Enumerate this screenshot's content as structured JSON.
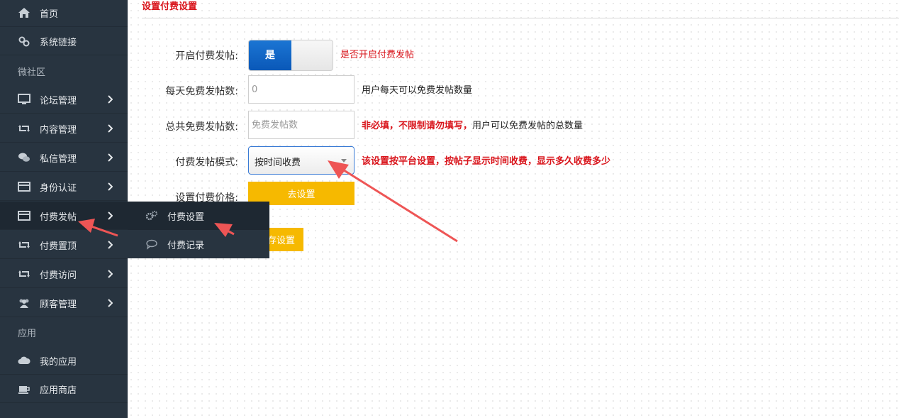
{
  "sidebar": {
    "items": [
      {
        "label": "首页",
        "icon": "home-icon"
      },
      {
        "label": "系统链接",
        "icon": "link-icon"
      },
      {
        "label": "论坛管理",
        "icon": "monitor-icon"
      },
      {
        "label": "内容管理",
        "icon": "retweet-icon"
      },
      {
        "label": "私信管理",
        "icon": "comments-icon"
      },
      {
        "label": "身份认证",
        "icon": "credit-card-icon"
      },
      {
        "label": "付费发帖",
        "icon": "credit-card-icon"
      },
      {
        "label": "付费置顶",
        "icon": "retweet-icon"
      },
      {
        "label": "付费访问",
        "icon": "retweet-icon"
      },
      {
        "label": "顾客管理",
        "icon": "users-icon"
      },
      {
        "label": "我的应用",
        "icon": "cloud-icon"
      },
      {
        "label": "应用商店",
        "icon": "coffee-icon"
      }
    ],
    "groups": {
      "community": "微社区",
      "apps": "应用"
    }
  },
  "flyout": {
    "items": [
      {
        "label": "付费设置",
        "icon": "gears-icon"
      },
      {
        "label": "付费记录",
        "icon": "comment-icon"
      }
    ]
  },
  "main": {
    "title": "设置付费设置",
    "fields": {
      "enable": {
        "label": "开启付费发帖:",
        "toggle_on_label": "是",
        "hint": "是否开启付费发帖"
      },
      "daily_free": {
        "label": "每天免费发帖数:",
        "value": "0",
        "hint": "用户每天可以免费发帖数量"
      },
      "total_free": {
        "label": "总共免费发帖数:",
        "placeholder": "免费发帖数",
        "hint_red": "非必填，不限制请勿填写，",
        "hint_dark": "用户可以免费发帖的总数量"
      },
      "mode": {
        "label": "付费发帖模式:",
        "selected": "按时间收费",
        "hint": "该设置按平台设置，按帖子显示时间收费，显示多久收费多少"
      },
      "price": {
        "label": "设置付费价格:",
        "button": "去设置"
      }
    },
    "save_button_visible_text": "存设置"
  },
  "colors": {
    "sidebar_bg": "#283440",
    "accent_red": "#d9141b",
    "button_yellow": "#f6b900",
    "toggle_blue": "#0a58b8",
    "annotation_arrow": "#ee5555"
  }
}
